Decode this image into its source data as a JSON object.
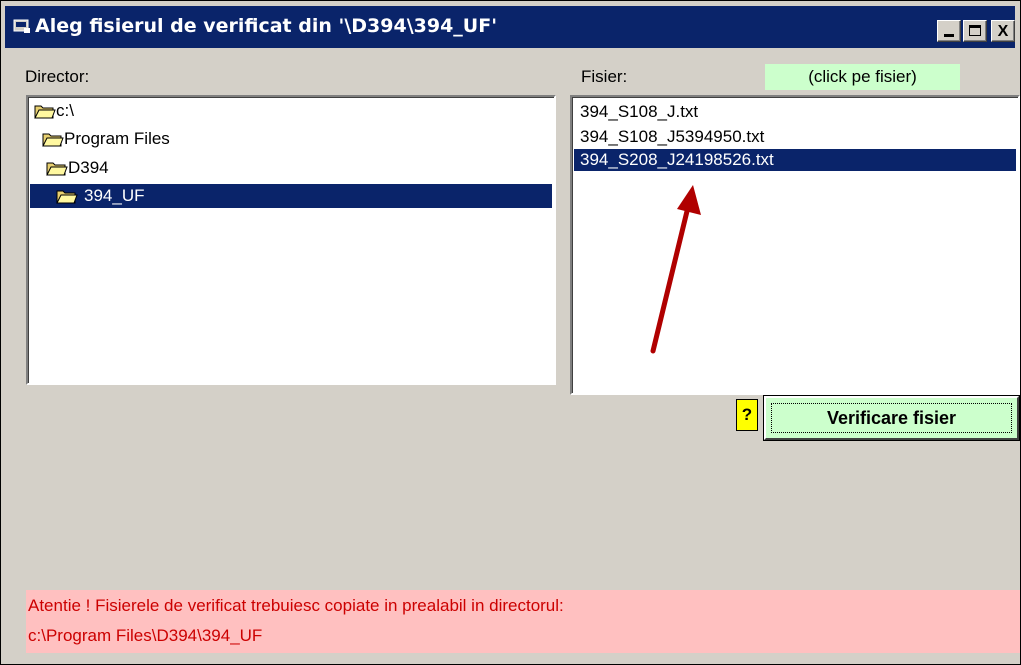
{
  "window": {
    "title": "Aleg fisierul de verificat din '\\D394\\394_UF'",
    "min_icon": "minimize-icon",
    "max_icon": "maximize-icon",
    "close_label": "X"
  },
  "director": {
    "label": "Director:",
    "items": [
      {
        "label": "c:\\",
        "icon": "open-folder-icon"
      },
      {
        "label": "Program Files",
        "icon": "open-folder-icon"
      },
      {
        "label": "D394",
        "icon": "open-folder-icon"
      },
      {
        "label": "394_UF",
        "icon": "open-folder-icon",
        "selected": true
      }
    ]
  },
  "fisier": {
    "label": "Fisier:",
    "hint": "(click pe fisier)",
    "files": [
      {
        "name": "394_S108_J.txt"
      },
      {
        "name": "394_S108_J5394950.txt"
      },
      {
        "name": "394_S208_J24198526.txt",
        "selected": true
      }
    ]
  },
  "actions": {
    "help_label": "?",
    "verify_label": "Verificare fisier"
  },
  "warning": {
    "line1": "Atentie ! Fisierele de verificat trebuiesc copiate in prealabil in directorul:",
    "line2": "c:\\Program Files\\D394\\394_UF"
  },
  "colors": {
    "titlebar": "#0a246a",
    "selection": "#0a246a",
    "hint_bg": "#ccffcc",
    "help_bg": "#ffff00",
    "warning_bg": "#ffc0c0",
    "warning_text": "#cc0000",
    "annotation_arrow": "#cc0000"
  }
}
